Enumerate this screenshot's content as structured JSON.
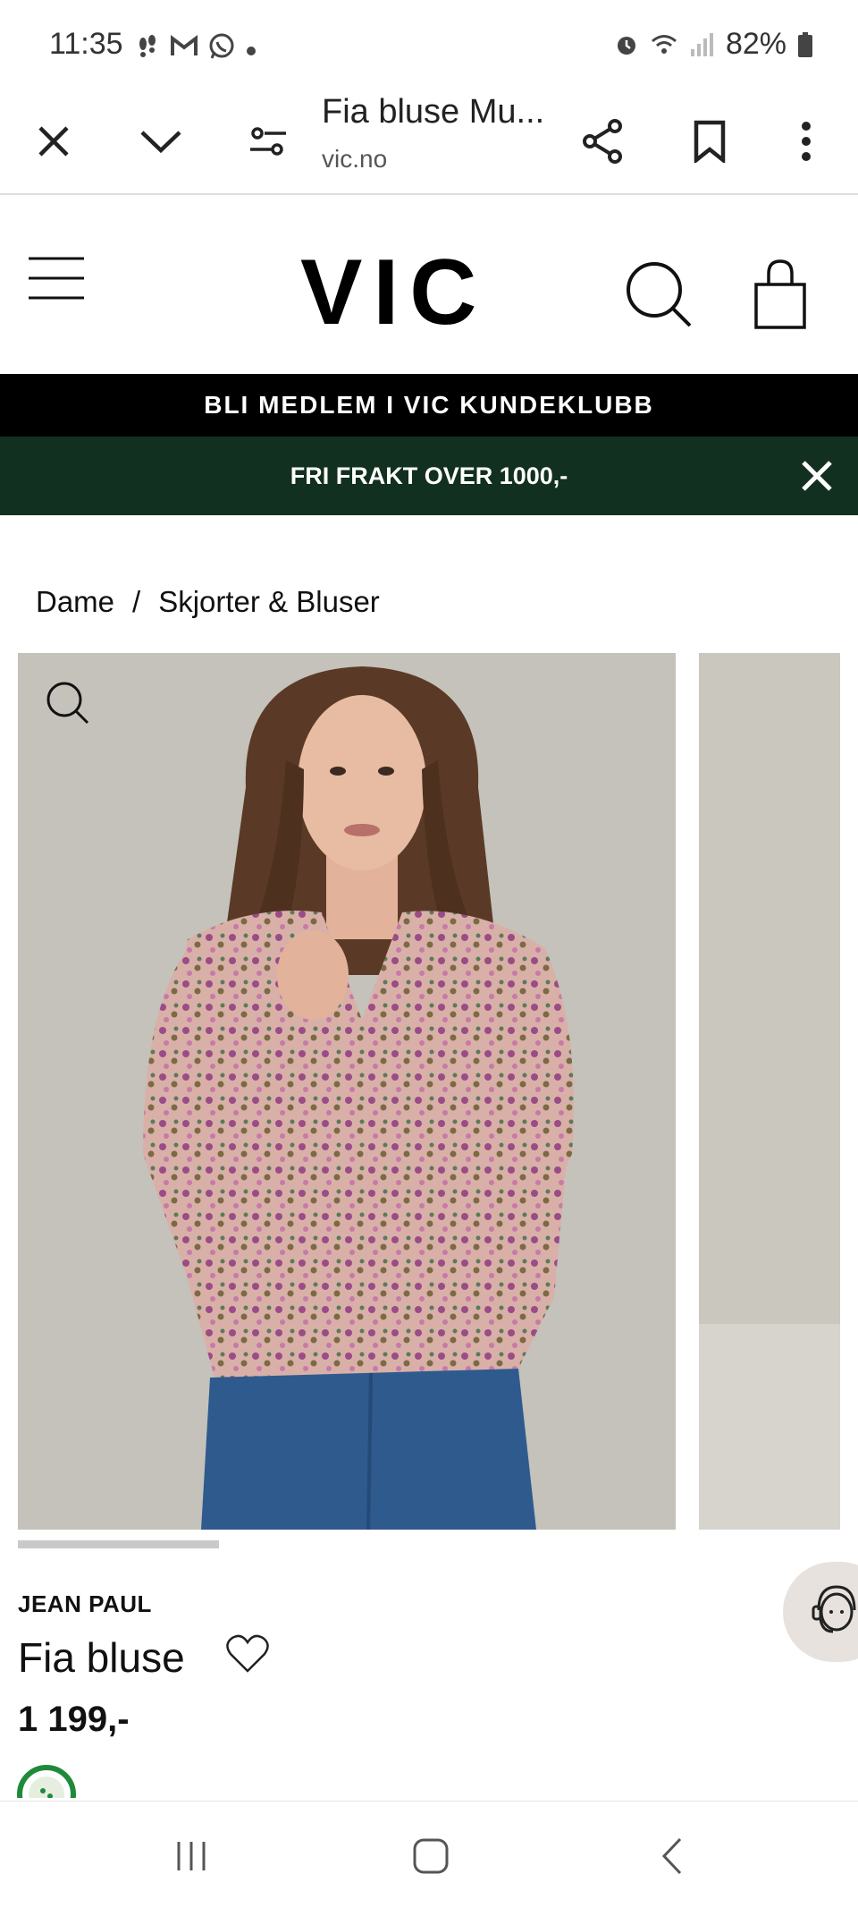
{
  "status_bar": {
    "time": "11:35",
    "battery": "82%",
    "left_icons": [
      "steps-icon",
      "gmail-icon",
      "whatsapp-icon",
      "dot-icon"
    ],
    "right_icons": [
      "alarm-icon",
      "wifi-icon",
      "signal-icon",
      "battery-icon"
    ]
  },
  "browser": {
    "title": "Fia bluse Mu...",
    "url": "vic.no"
  },
  "site": {
    "logo": "VIC",
    "member_banner": "BLI MEDLEM I VIC KUNDEKLUBB",
    "shipping_banner": "FRI FRAKT OVER 1000,-"
  },
  "breadcrumb": {
    "items": [
      "Dame",
      "Skjorter & Bluser"
    ],
    "separator": "/"
  },
  "product": {
    "brand": "JEAN PAUL",
    "name": "Fia bluse",
    "price": "1 199,-",
    "image_alt": "Model wearing floral pink blouse with jeans",
    "gallery_position": 0.23
  },
  "colors": {
    "black_banner": "#000000",
    "green_banner": "#12301f"
  }
}
